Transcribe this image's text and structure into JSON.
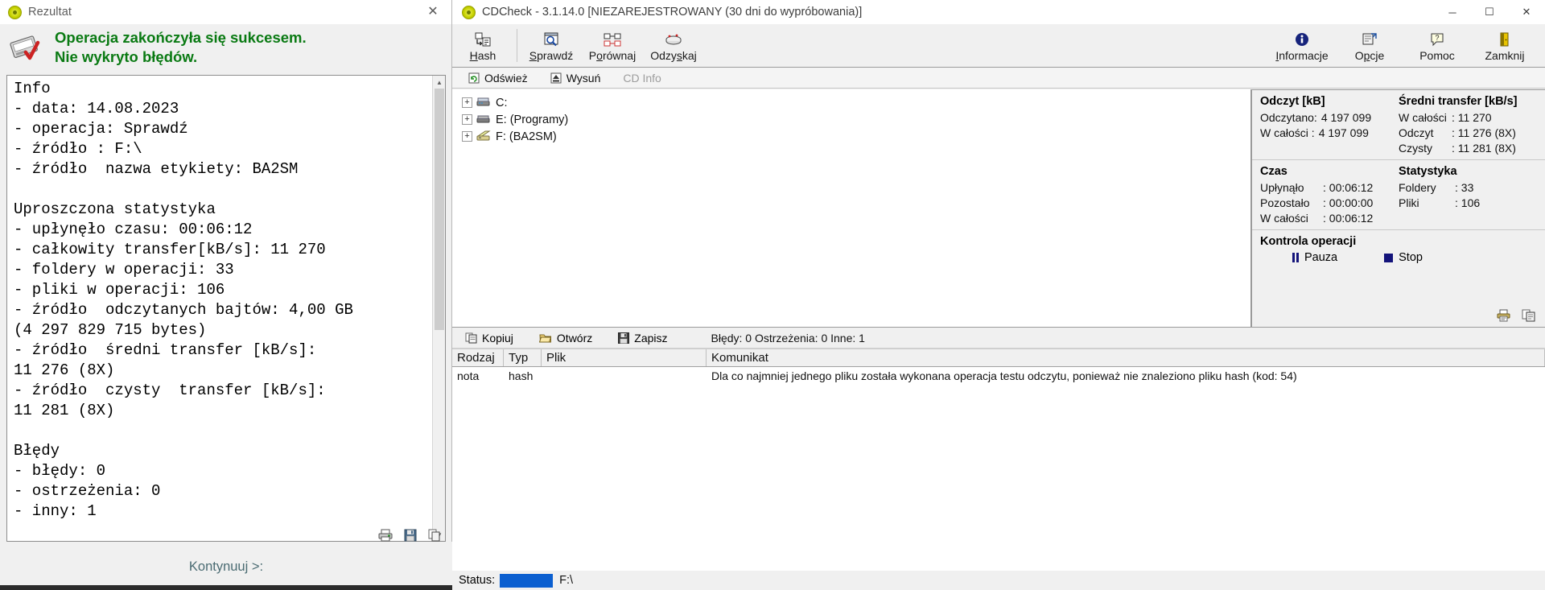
{
  "rezultat": {
    "title": "Rezultat",
    "title_icon": "cd-disc-icon",
    "close_label": "✕",
    "banner_icon": "cd-check-icon",
    "banner_line1": "Operacja zakończyła się sukcesem.",
    "banner_line2": "Nie wykryto błędów.",
    "banner_color": "#0a7a13",
    "log_text": "Info\n- data: 14.08.2023\n- operacja: Sprawdź\n- źródło : F:\\\n- źródło  nazwa etykiety: BA2SM\n\nUproszczona statystyka\n- upłynęło czasu: 00:06:12\n- całkowity transfer[kB/s]: 11 270\n- foldery w operacji: 33\n- pliki w operacji: 106\n- źródło  odczytanych bajtów: 4,00 GB\n(4 297 829 715 bytes)\n- źródło  średni transfer [kB/s]:\n11 276 (8X)\n- źródło  czysty  transfer [kB/s]:\n11 281 (8X)\n\nBłędy\n- błędy: 0\n- ostrzeżenia: 0\n- inny: 1",
    "continue_label": "Kontynuuj >:",
    "bottom_icons": [
      "printer-icon",
      "save-icon",
      "copy-icon"
    ]
  },
  "cdcheck": {
    "title": "CDCheck - 3.1.14.0 [NIEZAREJESTROWANY (30 dni do wypróbowania)]",
    "title_icon": "cd-disc-icon",
    "window_controls": [
      {
        "name": "minimize-button",
        "glyph": "─"
      },
      {
        "name": "maximize-button",
        "glyph": "☐"
      },
      {
        "name": "close-button",
        "glyph": "✕"
      }
    ],
    "toolbar_left": [
      {
        "name": "hash-button",
        "label": "Hash",
        "accel": "H",
        "icon": "hash-icon"
      }
    ],
    "toolbar_mid": [
      {
        "name": "sprawdz-button",
        "label": "Sprawdź",
        "accel": "S",
        "icon": "magnifier-disc-icon"
      },
      {
        "name": "porownaj-button",
        "label": "Porównaj",
        "accel": "o",
        "icon": "compare-icon"
      },
      {
        "name": "odzyskaj-button",
        "label": "Odzyskaj",
        "accel": "s",
        "icon": "recover-icon"
      }
    ],
    "toolbar_right": [
      {
        "name": "informacje-button",
        "label": "Informacje",
        "accel": "I",
        "icon": "info-icon"
      },
      {
        "name": "opcje-button",
        "label": "Opcje",
        "accel": "p",
        "icon": "options-icon"
      },
      {
        "name": "pomoc-button",
        "label": "Pomoc",
        "accel": "",
        "icon": "help-icon"
      },
      {
        "name": "zamknij-button",
        "label": "Zamknij",
        "accel": "",
        "icon": "exit-door-icon"
      }
    ],
    "subbar": [
      {
        "name": "odswiez-button",
        "label": "Odśwież",
        "icon": "refresh-icon",
        "disabled": false
      },
      {
        "name": "wysun-button",
        "label": "Wysuń",
        "icon": "eject-icon",
        "disabled": false
      },
      {
        "name": "cd-info-button",
        "label": "CD Info",
        "icon": "",
        "disabled": true
      }
    ],
    "tree": [
      {
        "name": "tree-item-c",
        "label": "C:",
        "icon": "hard-drive-icon",
        "expander": "+"
      },
      {
        "name": "tree-item-e",
        "label": "E: (Programy)",
        "icon": "hard-drive-icon",
        "expander": "+"
      },
      {
        "name": "tree-item-f",
        "label": "F: (BA2SM)",
        "icon": "optical-drive-icon",
        "expander": "+"
      }
    ],
    "stats": {
      "read": {
        "title": "Odczyt [kB]",
        "rows": [
          {
            "label": "Odczytano:",
            "value": "4 197 099"
          },
          {
            "label": "W całości :",
            "value": "4 197 099"
          }
        ]
      },
      "transfer": {
        "title": "Średni transfer [kB/s]",
        "rows": [
          {
            "label": "W całości",
            "value": ": 11 270"
          },
          {
            "label": "Odczyt  ",
            "value": ": 11 276 (8X)"
          },
          {
            "label": "Czysty  ",
            "value": ": 11 281 (8X)"
          }
        ]
      },
      "time": {
        "title": "Czas",
        "rows": [
          {
            "label": "Upłynąło  ",
            "value": ": 00:06:12"
          },
          {
            "label": "Pozostało ",
            "value": ": 00:00:00"
          },
          {
            "label": "W całości ",
            "value": ": 00:06:12"
          }
        ]
      },
      "statistics": {
        "title": "Statystyka",
        "rows": [
          {
            "label": "Foldery  ",
            "value": ": 33"
          },
          {
            "label": "Pliki    ",
            "value": ": 106"
          }
        ]
      },
      "copy_icons": [
        "print-report-icon",
        "copy-report-icon"
      ]
    },
    "operation_control": {
      "title": "Kontrola operacji",
      "pause_label": "Pauza",
      "stop_label": "Stop",
      "accent": "#13137a"
    },
    "logbar": {
      "buttons": [
        {
          "name": "kopiuj-button",
          "label": "Kopiuj",
          "icon": "copy-icon"
        },
        {
          "name": "otworz-button",
          "label": "Otwórz",
          "icon": "open-folder-icon"
        },
        {
          "name": "zapisz-button",
          "label": "Zapisz",
          "icon": "save-disk-icon"
        }
      ],
      "counts": "Błędy: 0 Ostrzeżenia: 0 Inne: 1"
    },
    "table": {
      "columns": [
        "Rodzaj",
        "Typ",
        "Plik",
        "Komunikat"
      ],
      "rows": [
        {
          "rodzaj": "nota",
          "typ": "hash",
          "plik": "",
          "komunikat": "Dla co najmniej jednego pliku została wykonana operacja testu odczytu, ponieważ nie znaleziono pliku hash (kod: 54)"
        }
      ]
    },
    "statusbar": {
      "label": "Status:",
      "progress_color": "#0b5fd0",
      "path": "F:\\"
    }
  }
}
